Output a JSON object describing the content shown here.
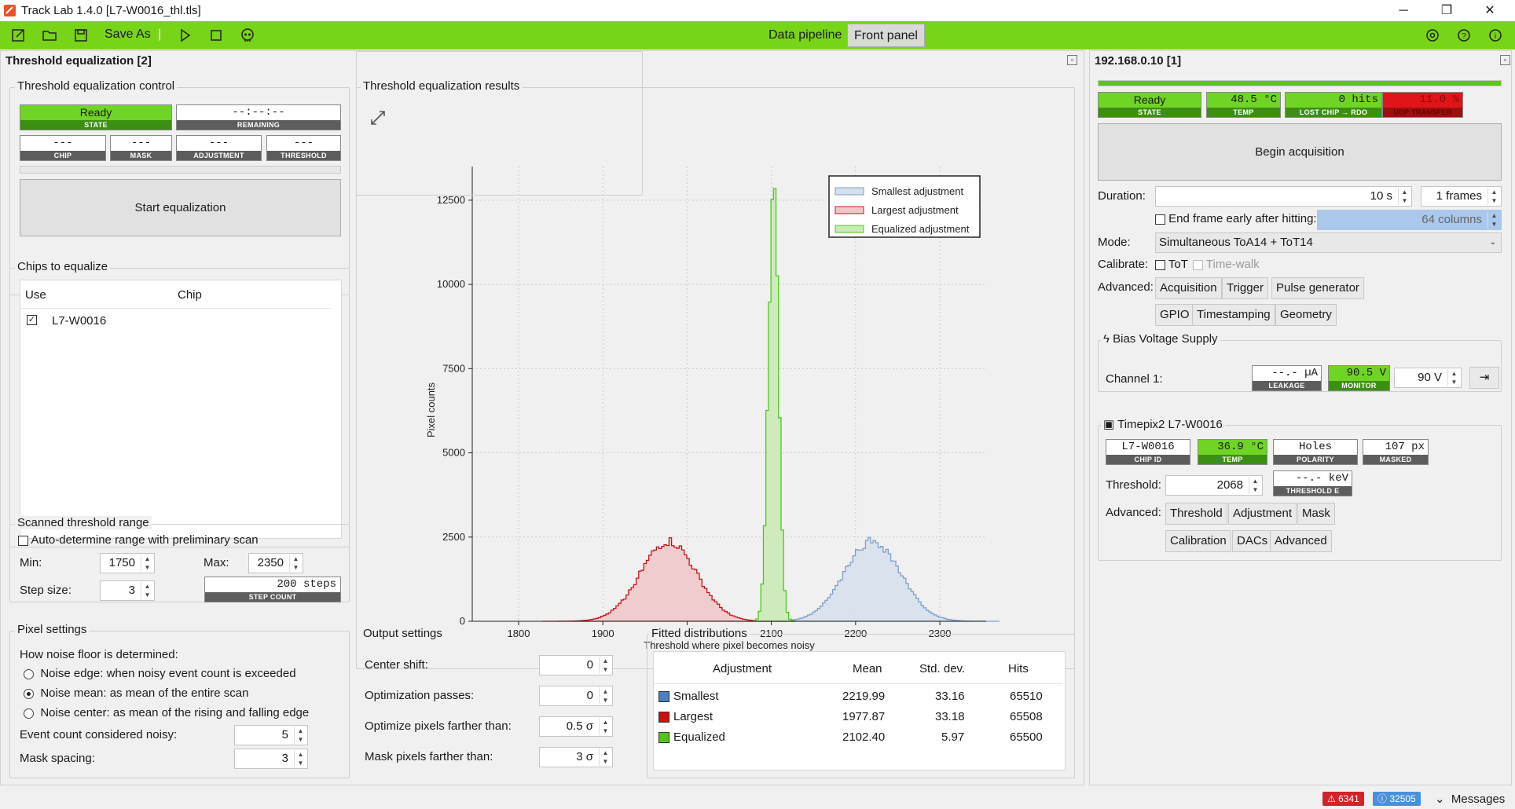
{
  "window": {
    "title": "Track Lab 1.4.0 [L7-W0016_thl.tls]",
    "minimize": "─",
    "restore": "❐",
    "close": "✕"
  },
  "toolbar": {
    "save_as": "Save As",
    "sep": "|",
    "tab_pipeline": "Data pipeline",
    "tab_front": "Front panel",
    "accent": "#78d417"
  },
  "left_panel": {
    "title": "Threshold equalization [2]",
    "control": {
      "title": "Threshold equalization control",
      "state": {
        "value": "Ready",
        "label": "STATE"
      },
      "remaining": {
        "value": "--:--:--",
        "label": "REMAINING"
      },
      "chip": {
        "value": "---",
        "label": "CHIP"
      },
      "mask": {
        "value": "---",
        "label": "MASK"
      },
      "adjustment": {
        "value": "---",
        "label": "ADJUSTMENT"
      },
      "threshold": {
        "value": "---",
        "label": "THRESHOLD"
      },
      "start_button": "Start equalization"
    },
    "chips": {
      "title": "Chips to equalize",
      "col_use": "Use",
      "col_chip": "Chip",
      "rows": [
        {
          "checked": true,
          "chip": "L7-W0016"
        }
      ]
    },
    "range": {
      "title": "Scanned threshold range",
      "auto_label": "Auto-determine range with preliminary scan",
      "min_label": "Min:",
      "min_value": "1750",
      "max_label": "Max:",
      "max_value": "2350",
      "step_label": "Step size:",
      "step_value": "3",
      "step_count": {
        "value": "200 steps",
        "label": "STEP COUNT"
      }
    },
    "pixel": {
      "title": "Pixel settings",
      "noise_label": "How noise floor is determined:",
      "options": [
        {
          "label": "Noise edge: when noisy event count is exceeded",
          "selected": false
        },
        {
          "label": "Noise mean: as mean of the entire scan",
          "selected": true
        },
        {
          "label": "Noise center: as mean of the rising and falling edge",
          "selected": false
        }
      ],
      "event_label": "Event count considered noisy:",
      "event_value": "5",
      "mask_label": "Mask spacing:",
      "mask_value": "3"
    }
  },
  "results": {
    "title": "Threshold equalization results"
  },
  "chart_data": {
    "type": "area",
    "title": "",
    "xlabel": "Threshold where pixel becomes noisy",
    "ylabel": "Pixel counts",
    "xlim": [
      1745,
      2355
    ],
    "ylim": [
      0,
      13500
    ],
    "xticks": [
      1800,
      1900,
      2000,
      2100,
      2200,
      2300
    ],
    "yticks": [
      0,
      2500,
      5000,
      7500,
      10000,
      12500
    ],
    "grid": true,
    "legend_position": "top-right",
    "series": [
      {
        "name": "Smallest adjustment",
        "color": "#7f9fc8",
        "fill": "#d5dfec",
        "mean": 2219.99,
        "std": 33.16,
        "count": 65510,
        "bin_width": 3
      },
      {
        "name": "Largest adjustment",
        "color": "#c8141a",
        "fill": "#f0c6c8",
        "mean": 1977.87,
        "std": 33.18,
        "count": 65508,
        "bin_width": 3
      },
      {
        "name": "Equalized adjustment",
        "color": "#4cc81e",
        "fill": "#c9eab4",
        "mean": 2102.4,
        "std": 5.97,
        "count": 65500,
        "bin_width": 3
      }
    ]
  },
  "output": {
    "title": "Output settings",
    "center_label": "Center shift:",
    "center_value": "0",
    "passes_label": "Optimization passes:",
    "passes_value": "0",
    "optimize_label": "Optimize pixels farther than:",
    "optimize_value": "0.5 σ",
    "maskfar_label": "Mask pixels farther than:",
    "maskfar_value": "3 σ"
  },
  "fitted": {
    "title": "Fitted distributions",
    "headers": [
      "Adjustment",
      "Mean",
      "Std. dev.",
      "Hits"
    ],
    "rows": [
      {
        "color": "#4a7fc1",
        "name": "Smallest",
        "mean": "2219.99",
        "std": "33.16",
        "hits": "65510"
      },
      {
        "color": "#cc1010",
        "name": "Largest",
        "mean": "1977.87",
        "std": "33.18",
        "hits": "65508"
      },
      {
        "color": "#52c41a",
        "name": "Equalized",
        "mean": "2102.40",
        "std": "5.97",
        "hits": "65500"
      }
    ]
  },
  "right_panel": {
    "title": "192.168.0.10 [1]",
    "progress": 1.0,
    "state": {
      "value": "Ready",
      "label": "STATE"
    },
    "temp": {
      "value": "48.5 °C",
      "label": "TEMP"
    },
    "lost": {
      "value": "0 hits",
      "label": "LOST CHIP → RDO"
    },
    "udp": {
      "value": "11.0 %",
      "label": "UDP TRANSFER"
    },
    "begin_button": "Begin acquisition",
    "duration_label": "Duration:",
    "duration_value": "10 s",
    "frames_value": "1 frames",
    "end_frame_label": "End frame early after hitting:",
    "end_frame_value": "64 columns",
    "mode_label": "Mode:",
    "mode_value": "Simultaneous ToA14 + ToT14",
    "calibrate_label": "Calibrate:",
    "tot_label": "ToT",
    "timewalk_label": "Time-walk",
    "advanced_label": "Advanced:",
    "adv_buttons": [
      "Acquisition",
      "Trigger",
      "Pulse generator",
      "GPIO",
      "Timestamping",
      "Geometry"
    ],
    "bias": {
      "title": "Bias Voltage Supply",
      "channel_label": "Channel 1:",
      "leakage": {
        "value": "--.- µA",
        "label": "LEAKAGE"
      },
      "monitor": {
        "value": "90.5 V",
        "label": "MONITOR"
      },
      "set_value": "90 V"
    },
    "chip": {
      "title": "Timepix2 L7-W0016",
      "chip_id": {
        "value": "L7-W0016",
        "label": "CHIP ID"
      },
      "temp": {
        "value": "36.9 °C",
        "label": "TEMP"
      },
      "polarity": {
        "value": "Holes",
        "label": "POLARITY"
      },
      "masked": {
        "value": "107 px",
        "label": "MASKED"
      },
      "threshold_label": "Threshold:",
      "threshold_value": "2068",
      "threshold_e": {
        "value": "--.- keV",
        "label": "THRESHOLD E"
      },
      "advanced_label": "Advanced:",
      "adv_buttons": [
        "Threshold",
        "Adjustment",
        "Mask",
        "Calibration",
        "DACs",
        "Advanced"
      ]
    }
  },
  "statusbar": {
    "errors": "6341",
    "infos": "32505",
    "messages": "Messages"
  }
}
